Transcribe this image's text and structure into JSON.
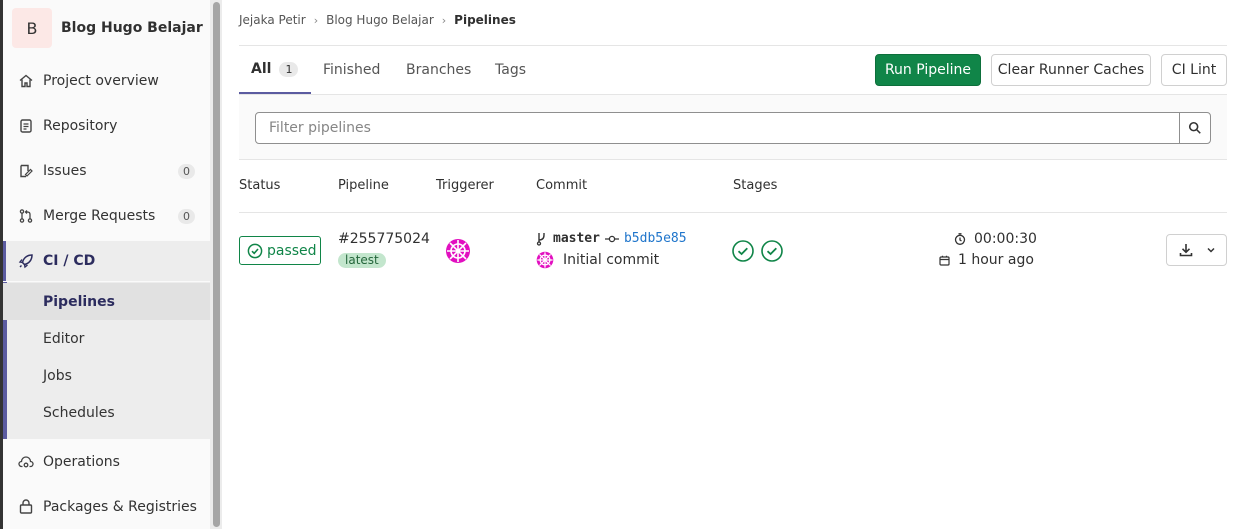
{
  "project": {
    "avatar_letter": "B",
    "name": "Blog Hugo Belajar"
  },
  "sidebar": {
    "items": [
      {
        "label": "Project overview",
        "icon": "home-icon"
      },
      {
        "label": "Repository",
        "icon": "document-icon"
      },
      {
        "label": "Issues",
        "icon": "issues-icon",
        "count": "0"
      },
      {
        "label": "Merge Requests",
        "icon": "merge-request-icon",
        "count": "0"
      },
      {
        "label": "CI / CD",
        "icon": "rocket-icon",
        "active": true
      },
      {
        "label": "Operations",
        "icon": "cloud-gear-icon"
      },
      {
        "label": "Packages & Registries",
        "icon": "package-icon"
      }
    ],
    "ci_sub_items": [
      {
        "label": "Pipelines",
        "active": true
      },
      {
        "label": "Editor"
      },
      {
        "label": "Jobs"
      },
      {
        "label": "Schedules"
      }
    ]
  },
  "breadcrumb": [
    "Jejaka Petir",
    "Blog Hugo Belajar",
    "Pipelines"
  ],
  "tabs": [
    {
      "label": "All",
      "count": "1",
      "active": true
    },
    {
      "label": "Finished"
    },
    {
      "label": "Branches"
    },
    {
      "label": "Tags"
    }
  ],
  "actions": {
    "run_pipeline": "Run Pipeline",
    "clear_caches": "Clear Runner Caches",
    "ci_lint": "CI Lint"
  },
  "filter": {
    "placeholder": "Filter pipelines"
  },
  "table": {
    "headers": [
      "Status",
      "Pipeline",
      "Triggerer",
      "Commit",
      "Stages"
    ],
    "rows": [
      {
        "status": "passed",
        "pipeline_id": "#255775024",
        "pipeline_badge": "latest",
        "branch": "master",
        "sha": "b5db5e85",
        "commit_message": "Initial commit",
        "duration": "00:00:30",
        "finished": "1 hour ago",
        "stages": [
          "passed",
          "passed"
        ]
      }
    ]
  },
  "colors": {
    "primary_green": "#108548",
    "accent_purple": "#5b5ba0",
    "link_blue": "#1f75cb",
    "avatar_magenta": "#e20fc0"
  }
}
